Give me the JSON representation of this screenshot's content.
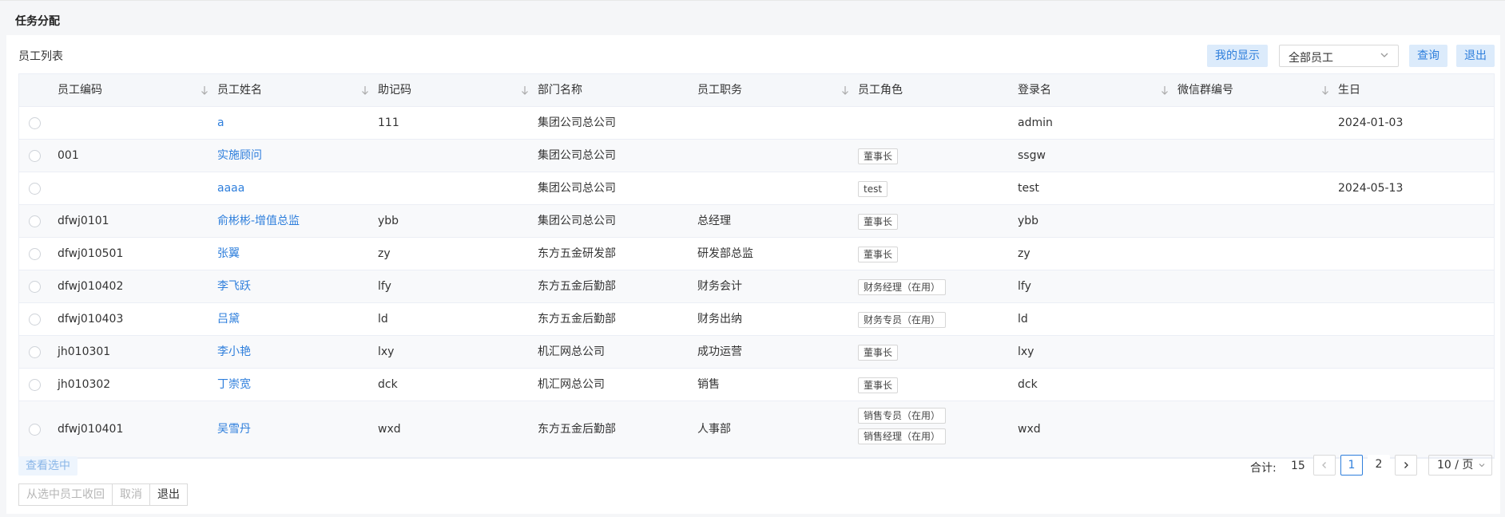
{
  "page": {
    "title": "任务分配"
  },
  "panel": {
    "list_title": "员工列表",
    "my_display_label": "我的显示",
    "filter": {
      "selected": "全部员工"
    },
    "query_label": "查询",
    "exit_label": "退出"
  },
  "table": {
    "columns": [
      "员工编码",
      "员工姓名",
      "助记码",
      "部门名称",
      "员工职务",
      "员工角色",
      "登录名",
      "微信群编号",
      "生日"
    ],
    "rows": [
      {
        "code": "",
        "name": "a",
        "mnemonic": "111",
        "dept": "集团公司总公司",
        "position": "",
        "roles": [],
        "login": "admin",
        "wechat": "",
        "birthday": "2024-01-03"
      },
      {
        "code": "001",
        "name": "实施顾问",
        "mnemonic": "",
        "dept": "集团公司总公司",
        "position": "",
        "roles": [
          "董事长"
        ],
        "login": "ssgw",
        "wechat": "",
        "birthday": ""
      },
      {
        "code": "",
        "name": "aaaa",
        "mnemonic": "",
        "dept": "集团公司总公司",
        "position": "",
        "roles": [
          "test"
        ],
        "login": "test",
        "wechat": "",
        "birthday": "2024-05-13"
      },
      {
        "code": "dfwj0101",
        "name": "俞彬彬-增值总监",
        "mnemonic": "ybb",
        "dept": "集团公司总公司",
        "position": "总经理",
        "roles": [
          "董事长"
        ],
        "login": "ybb",
        "wechat": "",
        "birthday": ""
      },
      {
        "code": "dfwj010501",
        "name": "张翼",
        "mnemonic": "zy",
        "dept": "东方五金研发部",
        "position": "研发部总监",
        "roles": [
          "董事长"
        ],
        "login": "zy",
        "wechat": "",
        "birthday": ""
      },
      {
        "code": "dfwj010402",
        "name": "李飞跃",
        "mnemonic": "lfy",
        "dept": "东方五金后勤部",
        "position": "财务会计",
        "roles": [
          "财务经理（在用）"
        ],
        "login": "lfy",
        "wechat": "",
        "birthday": ""
      },
      {
        "code": "dfwj010403",
        "name": "吕黛",
        "mnemonic": "ld",
        "dept": "东方五金后勤部",
        "position": "财务出纳",
        "roles": [
          "财务专员（在用）"
        ],
        "login": "ld",
        "wechat": "",
        "birthday": ""
      },
      {
        "code": "jh010301",
        "name": "李小艳",
        "mnemonic": "lxy",
        "dept": "机汇网总公司",
        "position": "成功运营",
        "roles": [
          "董事长"
        ],
        "login": "lxy",
        "wechat": "",
        "birthday": ""
      },
      {
        "code": "jh010302",
        "name": "丁崇宽",
        "mnemonic": "dck",
        "dept": "机汇网总公司",
        "position": "销售",
        "roles": [
          "董事长"
        ],
        "login": "dck",
        "wechat": "",
        "birthday": ""
      },
      {
        "code": "dfwj010401",
        "name": "吴雪丹",
        "mnemonic": "wxd",
        "dept": "东方五金后勤部",
        "position": "人事部",
        "roles": [
          "销售专员（在用）",
          "销售经理（在用）"
        ],
        "login": "wxd",
        "wechat": "",
        "birthday": ""
      }
    ]
  },
  "footer": {
    "view_selected_label": "查看选中",
    "recall_label": "从选中员工收回",
    "cancel_label": "取消",
    "exit_label": "退出"
  },
  "pagination": {
    "total_label": "合计:",
    "total": "15",
    "pages": [
      "1",
      "2"
    ],
    "current": "1",
    "page_size": "10 / 页"
  },
  "colors": {
    "accent": "#2f7fdc",
    "accent_light": "#dcebfb",
    "header_bg": "#f5f7fa"
  }
}
